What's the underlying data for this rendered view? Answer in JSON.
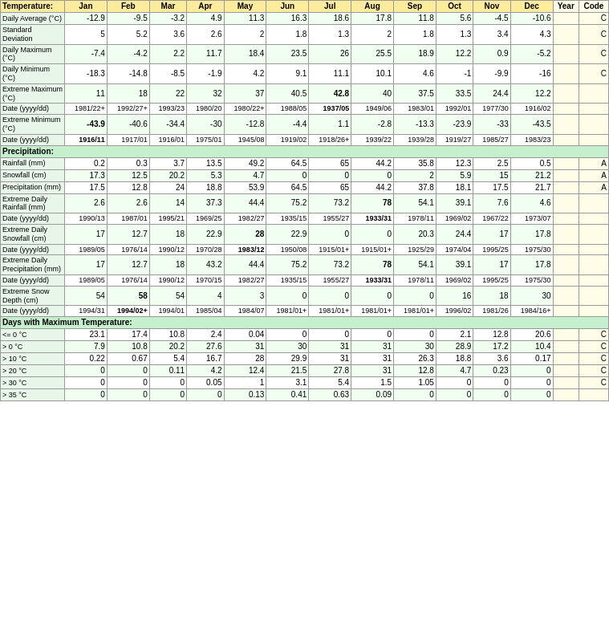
{
  "title": "Temperature:",
  "columns": [
    "Jan",
    "Feb",
    "Mar",
    "Apr",
    "May",
    "Jun",
    "Jul",
    "Aug",
    "Sep",
    "Oct",
    "Nov",
    "Dec",
    "Year",
    "Code"
  ],
  "rows": [
    {
      "label": "Daily Average (°C)",
      "values": [
        "-12.9",
        "-9.5",
        "-3.2",
        "4.9",
        "11.3",
        "16.3",
        "18.6",
        "17.8",
        "11.8",
        "5.6",
        "-4.5",
        "-10.6",
        "",
        "C"
      ],
      "bold_indices": []
    },
    {
      "label": "Standard Deviation",
      "values": [
        "5",
        "5.2",
        "3.6",
        "2.6",
        "2",
        "1.8",
        "1.3",
        "2",
        "1.8",
        "1.3",
        "3.4",
        "4.3",
        "",
        "C"
      ],
      "bold_indices": []
    },
    {
      "label": "Daily Maximum (°C)",
      "values": [
        "-7.4",
        "-4.2",
        "2.2",
        "11.7",
        "18.4",
        "23.5",
        "26",
        "25.5",
        "18.9",
        "12.2",
        "0.9",
        "-5.2",
        "",
        "C"
      ],
      "bold_indices": []
    },
    {
      "label": "Daily Minimum (°C)",
      "values": [
        "-18.3",
        "-14.8",
        "-8.5",
        "-1.9",
        "4.2",
        "9.1",
        "11.1",
        "10.1",
        "4.6",
        "-1",
        "-9.9",
        "-16",
        "",
        "C"
      ],
      "bold_indices": []
    },
    {
      "label": "Extreme Maximum (°C)",
      "values": [
        "11",
        "18",
        "22",
        "32",
        "37",
        "40.5",
        "42.8",
        "40",
        "37.5",
        "33.5",
        "24.4",
        "12.2",
        "",
        ""
      ],
      "bold_indices": [
        6
      ]
    },
    {
      "label": "Date (yyyy/dd)",
      "values": [
        "1981/22+",
        "1992/27+",
        "1993/23",
        "1980/20",
        "1980/22+",
        "1988/05",
        "1937/05",
        "1949/06",
        "1983/01",
        "1992/01",
        "1977/30",
        "1916/02",
        "",
        ""
      ],
      "bold_indices": [
        6
      ],
      "is_date": true
    },
    {
      "label": "Extreme Minimum (°C)",
      "values": [
        "-43.9",
        "-40.6",
        "-34.4",
        "-30",
        "-12.8",
        "-4.4",
        "1.1",
        "-2.8",
        "-13.3",
        "-23.9",
        "-33",
        "-43.5",
        "",
        ""
      ],
      "bold_indices": [
        0
      ]
    },
    {
      "label": "Date (yyyy/dd)",
      "values": [
        "1916/11",
        "1917/01",
        "1916/01",
        "1975/01",
        "1945/08",
        "1919/02",
        "1918/26+",
        "1939/22",
        "1939/28",
        "1919/27",
        "1985/27",
        "1983/23",
        "",
        ""
      ],
      "bold_indices": [
        0
      ],
      "is_date": true
    },
    {
      "section": "Precipitation:"
    },
    {
      "label": "Rainfall (mm)",
      "values": [
        "0.2",
        "0.3",
        "3.7",
        "13.5",
        "49.2",
        "64.5",
        "65",
        "44.2",
        "35.8",
        "12.3",
        "2.5",
        "0.5",
        "",
        "A"
      ],
      "bold_indices": []
    },
    {
      "label": "Snowfall (cm)",
      "values": [
        "17.3",
        "12.5",
        "20.2",
        "5.3",
        "4.7",
        "0",
        "0",
        "0",
        "2",
        "5.9",
        "15",
        "21.2",
        "",
        "A"
      ],
      "bold_indices": []
    },
    {
      "label": "Precipitation (mm)",
      "values": [
        "17.5",
        "12.8",
        "24",
        "18.8",
        "53.9",
        "64.5",
        "65",
        "44.2",
        "37.8",
        "18.1",
        "17.5",
        "21.7",
        "",
        "A"
      ],
      "bold_indices": []
    },
    {
      "label": "Extreme Daily Rainfall (mm)",
      "values": [
        "2.6",
        "2.6",
        "14",
        "37.3",
        "44.4",
        "75.2",
        "73.2",
        "78",
        "54.1",
        "39.1",
        "7.6",
        "4.6",
        "",
        ""
      ],
      "bold_indices": [
        7
      ]
    },
    {
      "label": "Date (yyyy/dd)",
      "values": [
        "1990/13",
        "1987/01",
        "1995/21",
        "1969/25",
        "1982/27",
        "1935/15",
        "1955/27",
        "1933/31",
        "1978/11",
        "1969/02",
        "1967/22",
        "1973/07",
        "",
        ""
      ],
      "bold_indices": [
        7
      ],
      "is_date": true
    },
    {
      "label": "Extreme Daily Snowfall (cm)",
      "values": [
        "17",
        "12.7",
        "18",
        "22.9",
        "28",
        "22.9",
        "0",
        "0",
        "20.3",
        "24.4",
        "17",
        "17.8",
        "",
        ""
      ],
      "bold_indices": [
        4
      ]
    },
    {
      "label": "Date (yyyy/dd)",
      "values": [
        "1989/05",
        "1976/14",
        "1990/12",
        "1970/28",
        "1983/12",
        "1950/08",
        "1915/01+",
        "1915/01+",
        "1925/29",
        "1974/04",
        "1995/25",
        "1975/30",
        "",
        ""
      ],
      "bold_indices": [
        4
      ],
      "is_date": true
    },
    {
      "label": "Extreme Daily Precipitation (mm)",
      "values": [
        "17",
        "12.7",
        "18",
        "43.2",
        "44.4",
        "75.2",
        "73.2",
        "78",
        "54.1",
        "39.1",
        "17",
        "17.8",
        "",
        ""
      ],
      "bold_indices": [
        7
      ]
    },
    {
      "label": "Date (yyyy/dd)",
      "values": [
        "1989/05",
        "1976/14",
        "1990/12",
        "1970/15",
        "1982/27",
        "1935/15",
        "1955/27",
        "1933/31",
        "1978/11",
        "1969/02",
        "1995/25",
        "1975/30",
        "",
        ""
      ],
      "bold_indices": [
        7
      ],
      "is_date": true
    },
    {
      "label": "Extreme Snow Depth (cm)",
      "values": [
        "54",
        "58",
        "54",
        "4",
        "3",
        "0",
        "0",
        "0",
        "0",
        "16",
        "18",
        "30",
        "",
        ""
      ],
      "bold_indices": [
        1
      ]
    },
    {
      "label": "Date (yyyy/dd)",
      "values": [
        "1994/31",
        "1994/02+",
        "1994/01",
        "1985/04",
        "1984/07",
        "1981/01+",
        "1981/01+",
        "1981/01+",
        "1981/01+",
        "1996/02",
        "1981/26",
        "1984/16+",
        "",
        ""
      ],
      "bold_indices": [
        1
      ],
      "is_date": true
    },
    {
      "section": "Days with Maximum Temperature:"
    },
    {
      "label": "<= 0 °C",
      "values": [
        "23.1",
        "17.4",
        "10.8",
        "2.4",
        "0.04",
        "0",
        "0",
        "0",
        "0",
        "2.1",
        "12.8",
        "20.6",
        "",
        "C"
      ],
      "bold_indices": []
    },
    {
      "label": "> 0 °C",
      "values": [
        "7.9",
        "10.8",
        "20.2",
        "27.6",
        "31",
        "30",
        "31",
        "31",
        "30",
        "28.9",
        "17.2",
        "10.4",
        "",
        "C"
      ],
      "bold_indices": []
    },
    {
      "label": "> 10 °C",
      "values": [
        "0.22",
        "0.67",
        "5.4",
        "16.7",
        "28",
        "29.9",
        "31",
        "31",
        "26.3",
        "18.8",
        "3.6",
        "0.17",
        "",
        "C"
      ],
      "bold_indices": []
    },
    {
      "label": "> 20 °C",
      "values": [
        "0",
        "0",
        "0.11",
        "4.2",
        "12.4",
        "21.5",
        "27.8",
        "31",
        "12.8",
        "4.7",
        "0.23",
        "0",
        "",
        "C"
      ],
      "bold_indices": []
    },
    {
      "label": "> 30 °C",
      "values": [
        "0",
        "0",
        "0",
        "0.05",
        "1",
        "3.1",
        "5.4",
        "1.5",
        "1.05",
        "0",
        "0",
        "0",
        "",
        "C"
      ],
      "bold_indices": []
    },
    {
      "label": "> 35 °C",
      "values": [
        "0",
        "0",
        "0",
        "0",
        "0.13",
        "0.41",
        "0.63",
        "0.09",
        "0",
        "0",
        "0",
        "0",
        "",
        ""
      ],
      "bold_indices": []
    }
  ]
}
